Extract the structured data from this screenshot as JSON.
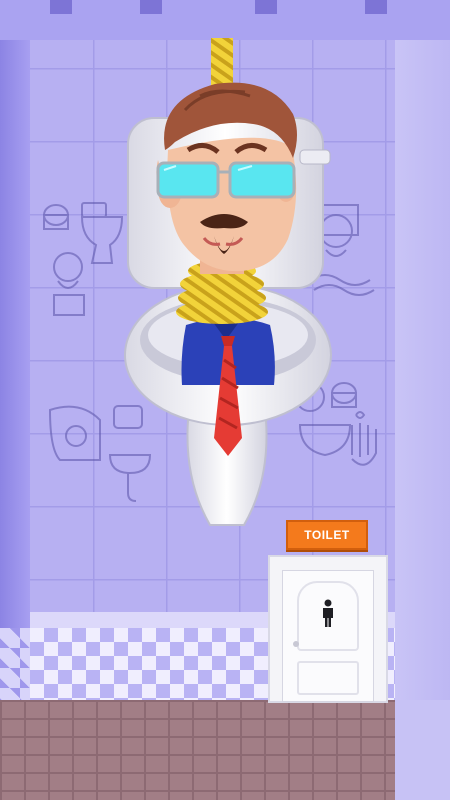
{
  "scene": {
    "sign_label": "TOILET",
    "character": "skibidi-toilet-man",
    "colors": {
      "wall": "#b7b0f2",
      "sign": "#f47a1c",
      "rope": "#f2d33a",
      "tie": "#e53b34",
      "shirt": "#2b41b8",
      "glasses": "#59e6f0"
    }
  }
}
